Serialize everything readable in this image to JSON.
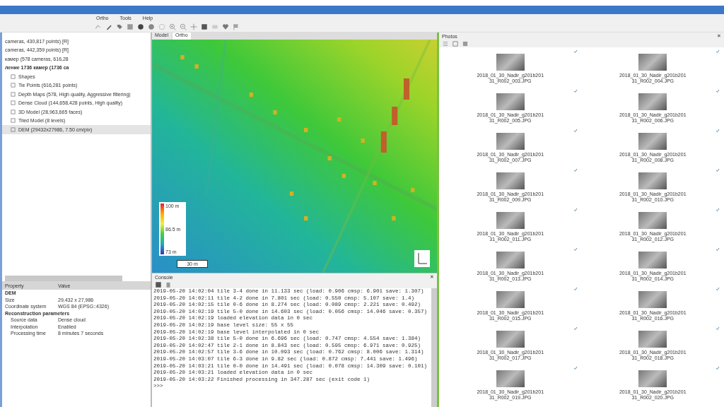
{
  "menu": [
    "Ortho",
    "Tools",
    "Help"
  ],
  "workspace": {
    "items": [
      {
        "label": "cameras, 430,817 points) [R]",
        "bold": false,
        "selected": false,
        "indent": false
      },
      {
        "label": "cameras, 442,359 points) [R]",
        "bold": false,
        "selected": false,
        "indent": false
      },
      {
        "label": "камер (578 cameras, 616,28",
        "bold": false,
        "selected": false,
        "indent": false
      },
      {
        "label": "ление 1736 камер (1736 ca",
        "bold": true,
        "selected": false,
        "indent": false
      },
      {
        "label": "Shapes",
        "bold": false,
        "selected": false,
        "indent": true
      },
      {
        "label": "Tie Points (616,281 points)",
        "bold": false,
        "selected": false,
        "indent": true
      },
      {
        "label": "Depth Maps (578, High quality, Aggressive filtering)",
        "bold": false,
        "selected": false,
        "indent": true
      },
      {
        "label": "Dense Cloud (144,658,428 points, High quality)",
        "bold": false,
        "selected": false,
        "indent": true
      },
      {
        "label": "3D Model (28,963,665 faces)",
        "bold": false,
        "selected": false,
        "indent": true
      },
      {
        "label": "Tiled Model (8 levels)",
        "bold": false,
        "selected": false,
        "indent": true
      },
      {
        "label": "DEM (29432x27986, 7.50 cm/pix)",
        "bold": false,
        "selected": true,
        "indent": true
      }
    ]
  },
  "properties": {
    "columns": [
      "Property",
      "Value"
    ],
    "rows": [
      {
        "kind": "section",
        "property": "DEM"
      },
      {
        "kind": "row",
        "property": "Size",
        "value": "29,432 x 27,986"
      },
      {
        "kind": "row",
        "property": "Coordinate system",
        "value": "WGS 84 (EPSG::4326)"
      },
      {
        "kind": "section",
        "property": "Reconstruction parameters"
      },
      {
        "kind": "subrow",
        "property": "Source data",
        "value": "Dense cloud"
      },
      {
        "kind": "subrow",
        "property": "Interpolation",
        "value": "Enabled"
      },
      {
        "kind": "subrow",
        "property": "Processing time",
        "value": "8 minutes 7 seconds"
      }
    ]
  },
  "view_tabs": [
    {
      "label": "Model",
      "selected": false
    },
    {
      "label": "Ortho",
      "selected": true
    }
  ],
  "map": {
    "legend": {
      "max": "100 m",
      "mid": "86.5 m",
      "min": "73 m"
    },
    "scale": "30 m"
  },
  "console": {
    "title": "Console",
    "close": "✕",
    "lines": [
      "2019-05-20 14:02:04 tile 3-4 done in 11.133 sec (load: 0.906 cmsp: 6.901 save: 1.307)",
      "2019-05-20 14:02:11 tile 4-2 done in 7.801 sec (load: 0.550 cmsp: 5.107 save: 1.4)",
      "2019-05-20 14:02:15 tile 0-6 done in 8.274 sec (load: 0.089 cmsp: 2.221 save: 0.492)",
      "2019-05-20 14:02:19 tile 5-0 done in 14.603 sec (load: 0.056 cmsp: 14.046 save: 0.357)",
      "2019-05-20 14:02:19 loaded elevation data in 0 sec",
      "2019-05-20 14:02:19 base level size: 55 x 55",
      "2019-05-20 14:02:19 base level interpolated in 0 sec",
      "2019-05-20 14:02:38 tile 5-0 done in 6.696 sec (load: 0.747 cmsp: 4.554 save: 1.384)",
      "2019-05-20 14:02:47 tile 2-1 done in 8.843 sec (load: 0.595 cmsp: 6.971 save: 0.925)",
      "2019-05-20 14:02:57 tile 3-6 done in 10.093 sec (load: 0.762 cmsp: 8.006 save: 1.314)",
      "2019-05-20 14:03:07 tile 6-3 done in 9.82 sec (load: 0.872 cmsp: 7.441 save: 1.496)",
      "2019-05-20 14:03:21 tile 0-0 done in 14.491 sec (load: 0.078 cmsp: 14.309 save: 0.101)",
      "2019-05-20 14:03:21 loaded elevation data in 0 sec",
      "2019-05-20 14:03:22 Finished processing in 347.287 sec (exit code 1)",
      ">>>"
    ]
  },
  "photos": {
    "title": "Photos",
    "close": "✕",
    "items": [
      "2018_01_30_Nadir_g201b20131_R002_003.JPG",
      "2018_01_30_Nadir_g201b20131_R002_004.JPG",
      "2018_01_30_Nadir_g201b20131_R002_005.JPG",
      "2018_01_30_Nadir_g201b20131_R002_006.JPG",
      "2018_01_30_Nadir_g201b20131_R002_007.JPG",
      "2018_01_30_Nadir_g201b20131_R002_008.JPG",
      "2018_01_30_Nadir_g201b20131_R002_009.JPG",
      "2018_01_30_Nadir_g201b20131_R002_010.JPG",
      "2018_01_30_Nadir_g201b20131_R002_011.JPG",
      "2018_01_30_Nadir_g201b20131_R002_012.JPG",
      "2018_01_30_Nadir_g201b20131_R002_013.JPG",
      "2018_01_30_Nadir_g201b20131_R002_014.JPG",
      "2018_01_30_Nadir_g201b20131_R002_015.JPG",
      "2018_01_30_Nadir_g201b20131_R002_016.JPG",
      "2018_01_30_Nadir_g201b20131_R002_017.JPG",
      "2018_01_30_Nadir_g201b20131_R002_018.JPG",
      "2018_01_30_Nadir_g201b20131_R002_019.JPG",
      "2018_01_30_Nadir_g201b20131_R002_020.JPG"
    ]
  }
}
